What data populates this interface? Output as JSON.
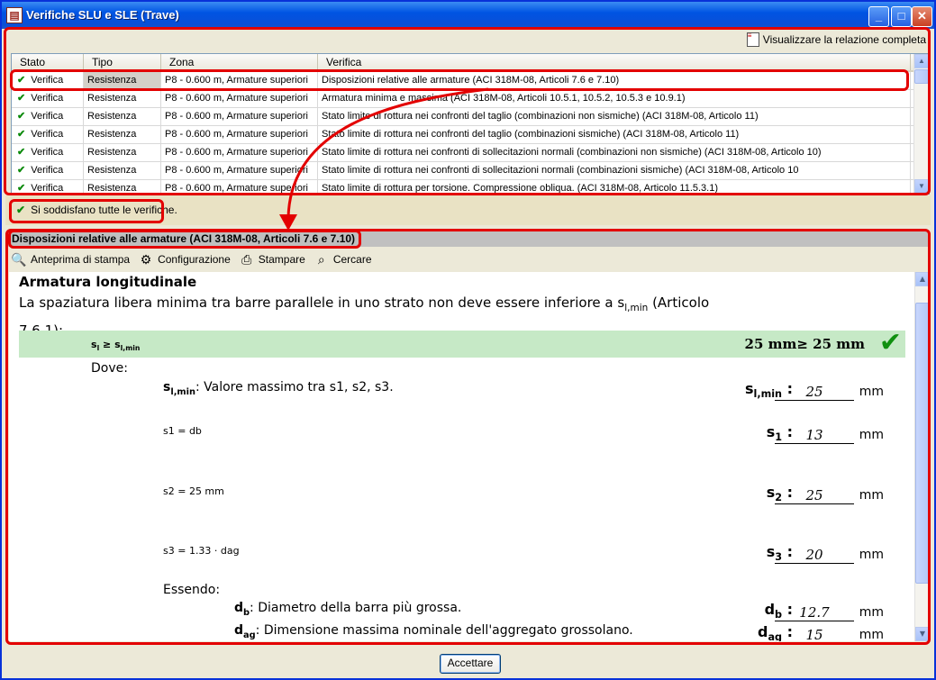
{
  "window": {
    "title": "Verifiche SLU e SLE (Trave)"
  },
  "toolbar": {
    "report_label": "Visualizzare la relazione completa"
  },
  "grid": {
    "columns": [
      "Stato",
      "Tipo",
      "Zona",
      "Verifica"
    ],
    "rows": [
      {
        "stato": "Verifica",
        "tipo": "Resistenza",
        "zona": "P8 - 0.600 m, Armature superiori",
        "verifica": "Disposizioni relative alle armature (ACI 318M-08, Articoli 7.6 e 7.10)"
      },
      {
        "stato": "Verifica",
        "tipo": "Resistenza",
        "zona": "P8 - 0.600 m, Armature superiori",
        "verifica": "Armatura minima e massima (ACI 318M-08, Articoli 10.5.1, 10.5.2, 10.5.3 e 10.9.1)"
      },
      {
        "stato": "Verifica",
        "tipo": "Resistenza",
        "zona": "P8 - 0.600 m, Armature superiori",
        "verifica": "Stato limite di rottura nei confronti del taglio (combinazioni non sismiche) (ACI 318M-08, Articolo 11)"
      },
      {
        "stato": "Verifica",
        "tipo": "Resistenza",
        "zona": "P8 - 0.600 m, Armature superiori",
        "verifica": "Stato limite di rottura nei confronti del taglio (combinazioni sismiche) (ACI 318M-08, Articolo 11)"
      },
      {
        "stato": "Verifica",
        "tipo": "Resistenza",
        "zona": "P8 - 0.600 m, Armature superiori",
        "verifica": "Stato limite di rottura nei confronti di sollecitazioni normali (combinazioni non sismiche) (ACI 318M-08, Articolo 10)"
      },
      {
        "stato": "Verifica",
        "tipo": "Resistenza",
        "zona": "P8 - 0.600 m, Armature superiori",
        "verifica": "Stato limite di rottura nei confronti di sollecitazioni normali (combinazioni sismiche) (ACI 318M-08, Articolo 10"
      },
      {
        "stato": "Verifica",
        "tipo": "Resistenza",
        "zona": "P8 - 0.600 m, Armature superiori",
        "verifica": "Stato limite di rottura per torsione. Compressione obliqua. (ACI 318M-08, Articolo 11.5.3.1)"
      }
    ]
  },
  "status": {
    "text": "Si soddisfano tutte le verifiche."
  },
  "detail": {
    "title": "Disposizioni relative alle armature (ACI 318M-08, Articoli 7.6 e 7.10)",
    "tools": [
      "Anteprima di stampa",
      "Configurazione",
      "Stampare",
      "Cercare"
    ],
    "section": "Armatura longitudinale",
    "para_text": "La spaziatura libera minima tra barre parallele in uno strato non deve essere inferiore a",
    "para_sym": "s",
    "para_sub": "l,min",
    "para_ref": "(Articolo 7.6.1):",
    "check_left": "s",
    "check_left_sub1": "l",
    "check_left_op": "≥ s",
    "check_left_sub2": "l,min",
    "check_value": "25 mm≥  25 mm",
    "dove": "Dove:",
    "essendo": "Essendo:",
    "unit": "mm",
    "slmin": {
      "desc": "Valore massimo tra s1, s2, s3.",
      "sym": "s",
      "sub": "l,min",
      "value": "25"
    },
    "s1": {
      "formula": "s1 = db",
      "sym": "s",
      "sub": "1",
      "value": "13"
    },
    "s2": {
      "formula": "s2 = 25 mm",
      "sym": "s",
      "sub": "2",
      "value": "25"
    },
    "s3": {
      "formula": "s3 = 1.33 · dag",
      "sym": "s",
      "sub": "3",
      "value": "20"
    },
    "db": {
      "desc": "Diametro della barra più grossa.",
      "sym": "d",
      "sub": "b",
      "value": "12.7"
    },
    "dag": {
      "desc": "Dimensione massima nominale dell'aggregato grossolano.",
      "sym": "d",
      "sub": "ag",
      "value": "15"
    }
  },
  "footer": {
    "accept_label": "Accettare"
  },
  "colors": {
    "highlight": "#e30000",
    "pass_green": "#c6e9c6",
    "check": "#109010"
  }
}
